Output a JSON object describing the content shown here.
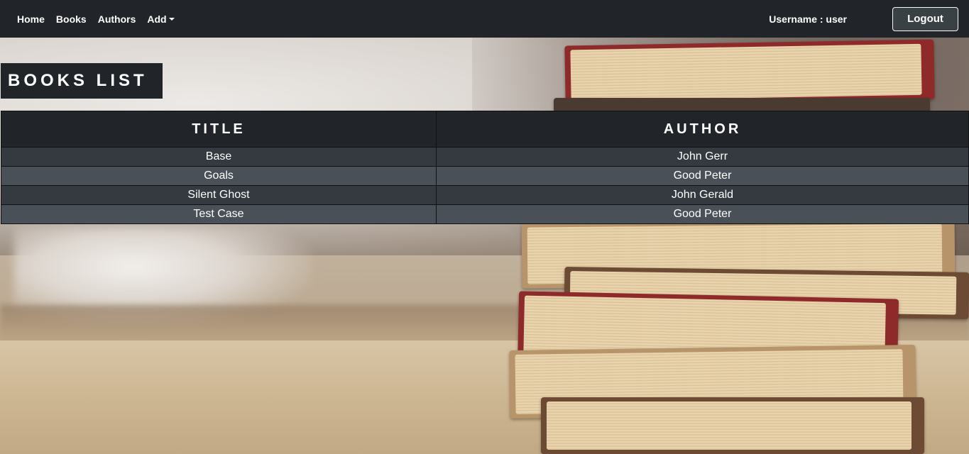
{
  "navbar": {
    "links": [
      {
        "label": "Home"
      },
      {
        "label": "Books"
      },
      {
        "label": "Authors"
      },
      {
        "label": "Add"
      }
    ],
    "username_text": "Username : user",
    "logout_label": "Logout"
  },
  "page": {
    "title": "BOOKS LIST"
  },
  "table": {
    "headers": [
      "TITLE",
      "AUTHOR"
    ],
    "rows": [
      {
        "title": "Base",
        "author": "John Gerr"
      },
      {
        "title": "Goals",
        "author": "Good Peter"
      },
      {
        "title": "Silent Ghost",
        "author": "John Gerald"
      },
      {
        "title": "Test Case",
        "author": "Good Peter"
      }
    ]
  },
  "colors": {
    "navbar_bg": "#212529",
    "row_odd": "#343a40",
    "row_even": "#495057",
    "logout_bg": "#3a4145"
  },
  "icons": {
    "add_dropdown": "caret-down-icon"
  }
}
